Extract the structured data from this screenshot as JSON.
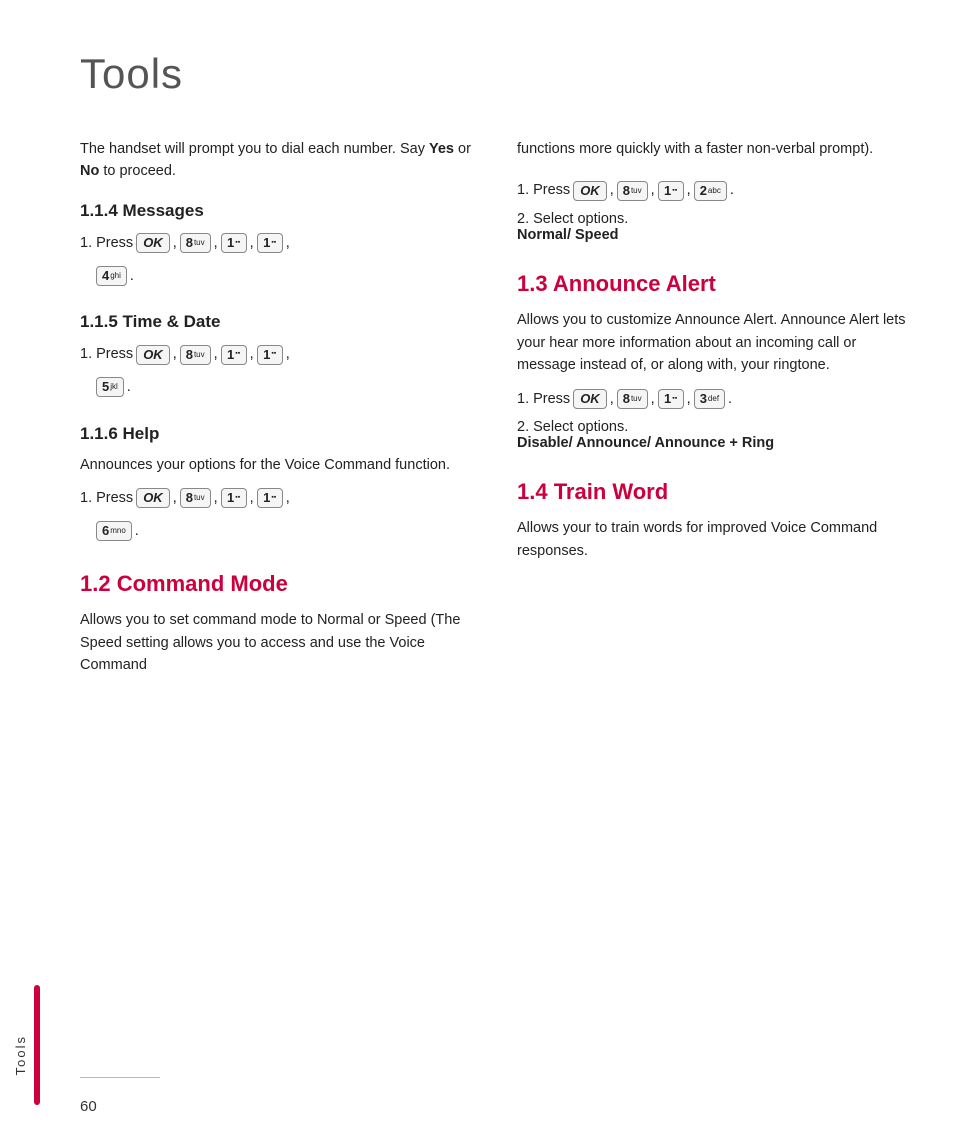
{
  "page": {
    "title": "Tools",
    "page_number": "60",
    "sidebar_label": "Tools"
  },
  "left_col": {
    "intro": {
      "text": "The handset will prompt you to dial each number. Say ",
      "text2": "Yes",
      "text3": " or ",
      "text4": "No",
      "text5": " to proceed."
    },
    "section_114": {
      "heading": "1.1.4 Messages",
      "press1": "1. Press",
      "keys": [
        "OK",
        "8 tuv",
        "1",
        "1",
        "4 ghi"
      ]
    },
    "section_115": {
      "heading": "1.1.5 Time & Date",
      "press1": "1. Press",
      "keys": [
        "OK",
        "8 tuv",
        "1",
        "1",
        "5 jkl"
      ]
    },
    "section_116": {
      "heading": "1.1.6 Help",
      "desc": "Announces your options for the Voice Command function.",
      "press1": "1. Press",
      "keys": [
        "OK",
        "8 tuv",
        "1",
        "1",
        "6 mno"
      ]
    },
    "section_12": {
      "heading": "1.2 Command Mode",
      "desc": "Allows you to set command mode to Normal or Speed (The Speed setting allows you to access and use the Voice Command"
    }
  },
  "right_col": {
    "cont_text": "functions more quickly with a faster non-verbal prompt).",
    "press_12": "1. Press",
    "keys_12": [
      "OK",
      "8 tuv",
      "1",
      "2 abc"
    ],
    "select_12": "2. Select options.",
    "select_12_val": "Normal/ Speed",
    "section_13": {
      "heading": "1.3 Announce Alert",
      "desc": "Allows you to customize Announce Alert. Announce Alert lets your hear more information about an incoming call or message instead of, or along with, your ringtone.",
      "press1": "1. Press",
      "keys": [
        "OK",
        "8 tuv",
        "1",
        "3 def"
      ],
      "select": "2. Select options.",
      "select_val": "Disable/ Announce/ Announce + Ring"
    },
    "section_14": {
      "heading": "1.4 Train Word",
      "desc": "Allows your to train words for improved Voice Command responses."
    }
  },
  "key_labels": {
    "ok": "OK",
    "8tuv": "8",
    "8tuv_sub": "tuv",
    "1": "1",
    "2abc": "2",
    "2abc_sub": "abc",
    "3def": "3",
    "3def_sub": "def",
    "4ghi": "4",
    "4ghi_sub": "ghi",
    "5jkl": "5",
    "5jkl_sub": "jkl",
    "6mno": "6",
    "6mno_sub": "mno"
  }
}
